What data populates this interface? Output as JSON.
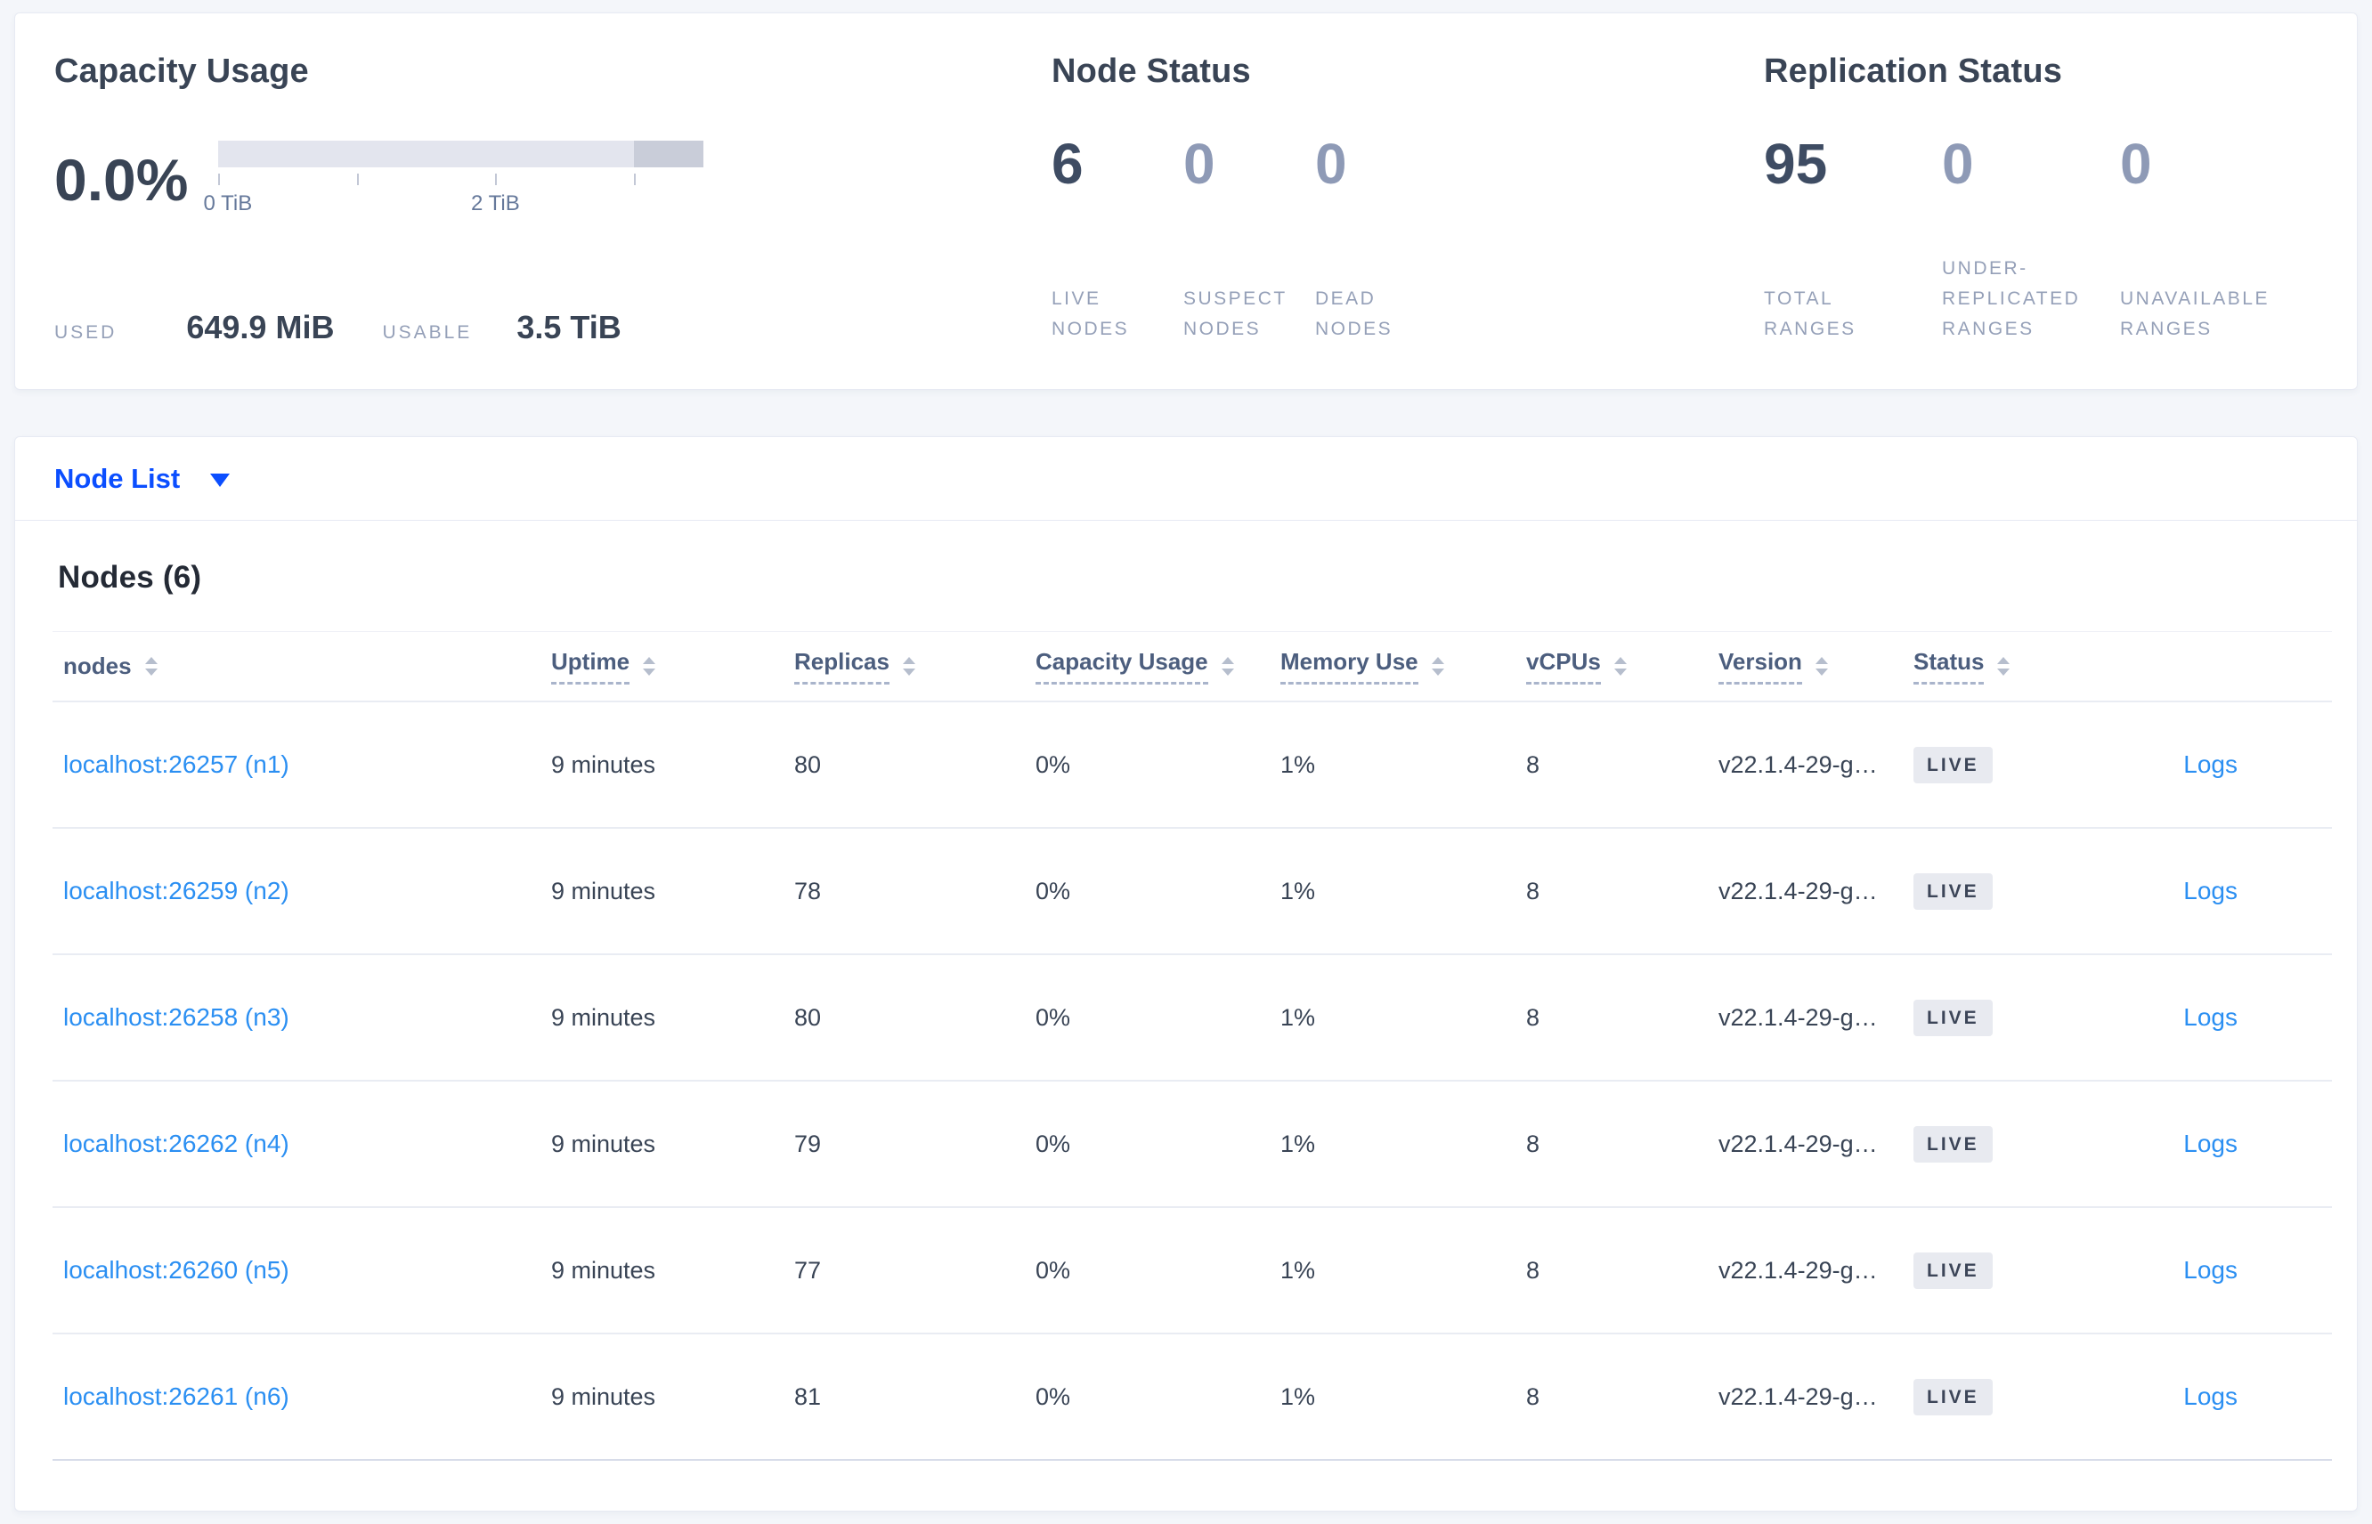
{
  "summary": {
    "capacity": {
      "title": "Capacity Usage",
      "percent": "0.0%",
      "tick_labels": [
        "0 TiB",
        "2 TiB"
      ],
      "used_label": "USED",
      "used_value": "649.9 MiB",
      "usable_label": "USABLE",
      "usable_value": "3.5 TiB"
    },
    "node_status": {
      "title": "Node Status",
      "stats": [
        {
          "value": "6",
          "label_lines": [
            "LIVE",
            "NODES"
          ]
        },
        {
          "value": "0",
          "label_lines": [
            "SUSPECT",
            "NODES"
          ]
        },
        {
          "value": "0",
          "label_lines": [
            "DEAD",
            "NODES"
          ]
        }
      ]
    },
    "replication_status": {
      "title": "Replication Status",
      "stats": [
        {
          "value": "95",
          "label_lines": [
            "TOTAL",
            "RANGES"
          ]
        },
        {
          "value": "0",
          "label_lines": [
            "UNDER-",
            "REPLICATED",
            "RANGES"
          ]
        },
        {
          "value": "0",
          "label_lines": [
            "UNAVAILABLE",
            "RANGES"
          ]
        }
      ]
    }
  },
  "view_selector": {
    "label": "Node List"
  },
  "nodes_table": {
    "title": "Nodes (6)",
    "columns": [
      "nodes",
      "Uptime",
      "Replicas",
      "Capacity Usage",
      "Memory Use",
      "vCPUs",
      "Version",
      "Status"
    ],
    "rows": [
      {
        "node": "localhost:26257 (n1)",
        "uptime": "9 minutes",
        "replicas": "80",
        "capacity": "0%",
        "memory": "1%",
        "vcpus": "8",
        "version": "v22.1.4-29-g…",
        "status": "LIVE",
        "logs": "Logs"
      },
      {
        "node": "localhost:26259 (n2)",
        "uptime": "9 minutes",
        "replicas": "78",
        "capacity": "0%",
        "memory": "1%",
        "vcpus": "8",
        "version": "v22.1.4-29-g…",
        "status": "LIVE",
        "logs": "Logs"
      },
      {
        "node": "localhost:26258 (n3)",
        "uptime": "9 minutes",
        "replicas": "80",
        "capacity": "0%",
        "memory": "1%",
        "vcpus": "8",
        "version": "v22.1.4-29-g…",
        "status": "LIVE",
        "logs": "Logs"
      },
      {
        "node": "localhost:26262 (n4)",
        "uptime": "9 minutes",
        "replicas": "79",
        "capacity": "0%",
        "memory": "1%",
        "vcpus": "8",
        "version": "v22.1.4-29-g…",
        "status": "LIVE",
        "logs": "Logs"
      },
      {
        "node": "localhost:26260 (n5)",
        "uptime": "9 minutes",
        "replicas": "77",
        "capacity": "0%",
        "memory": "1%",
        "vcpus": "8",
        "version": "v22.1.4-29-g…",
        "status": "LIVE",
        "logs": "Logs"
      },
      {
        "node": "localhost:26261 (n6)",
        "uptime": "9 minutes",
        "replicas": "81",
        "capacity": "0%",
        "memory": "1%",
        "vcpus": "8",
        "version": "v22.1.4-29-g…",
        "status": "LIVE",
        "logs": "Logs"
      }
    ]
  },
  "colors": {
    "page_background": "#f4f6fa",
    "primary_blue": "#0b4eff",
    "link_blue": "#2b8ff2",
    "dark_text": "#394455",
    "muted_label": "#95a0b8",
    "badge_background": "#e8eaf0",
    "bar_track": "#e3e5ee",
    "bar_segment": "#c9cdd9"
  }
}
